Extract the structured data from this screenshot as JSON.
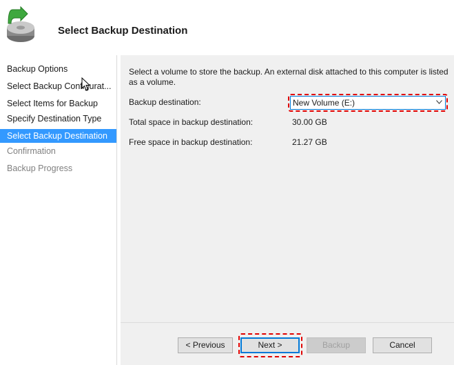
{
  "header": {
    "title": "Select Backup Destination",
    "icon": "backup-disk-icon"
  },
  "sidebar": {
    "items": [
      {
        "label": "Backup Options",
        "state": "normal"
      },
      {
        "label": "Select Backup Configurat...",
        "state": "normal"
      },
      {
        "label": "Select Items for Backup",
        "state": "normal"
      },
      {
        "label": "Specify Destination Type",
        "state": "normal"
      },
      {
        "label": "Select Backup Destination",
        "state": "active"
      },
      {
        "label": "Confirmation",
        "state": "disabled"
      },
      {
        "label": "Backup Progress",
        "state": "disabled"
      }
    ]
  },
  "main": {
    "intro": "Select a volume to store the backup. An external disk attached to this computer is listed as a volume.",
    "destination_label": "Backup destination:",
    "destination_value": "New Volume (E:)",
    "total_label": "Total space in backup destination:",
    "total_value": "30.00 GB",
    "free_label": "Free space in backup destination:",
    "free_value": "21.27 GB"
  },
  "footer": {
    "previous": "< Previous",
    "next": "Next >",
    "backup": "Backup",
    "cancel": "Cancel"
  },
  "colors": {
    "selection": "#3399ff",
    "highlight": "#e00000",
    "focus": "#0078d7",
    "panel": "#f0f0f0"
  }
}
